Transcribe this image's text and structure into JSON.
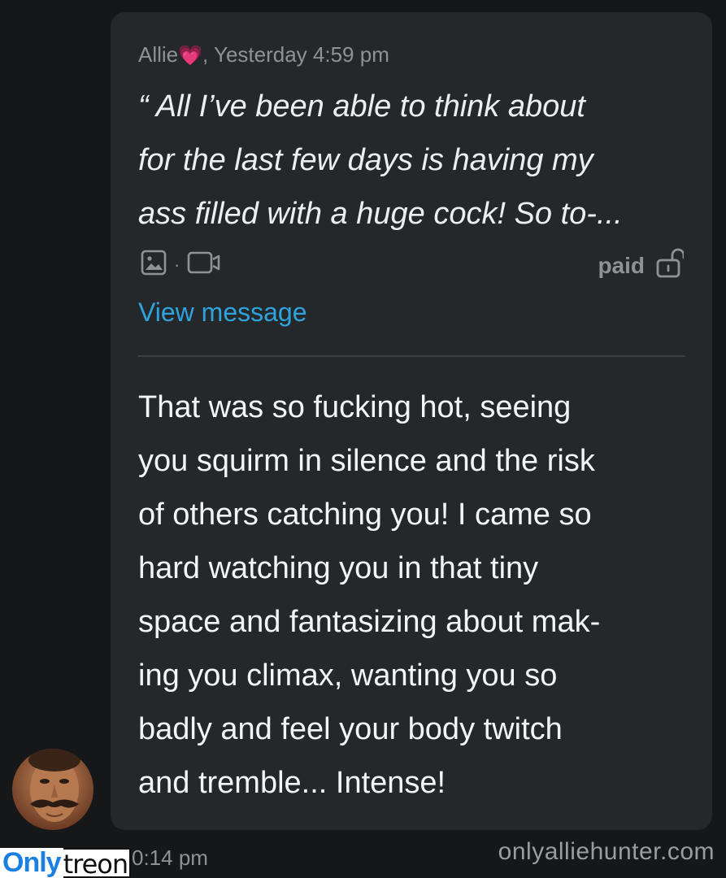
{
  "message": {
    "sender": "Allie",
    "sender_heart": "💗",
    "timestamp": ", Yesterday 4:59 pm",
    "quoted_text": "“ All I’ve been able to think about\nfor the last few days is having my\nass filled with a huge cock! So to-...",
    "media_icons": [
      "image-icon",
      "video-icon"
    ],
    "media_separator": "·",
    "paid_label": "paid",
    "paid_icon": "unlock-icon",
    "view_link": "View message",
    "reply_text": "That was so fucking hot, seeing\nyou squirm in silence and the risk\nof others catching you! I came so\nhard watching you in that tiny\nspace and fantasizing about mak-\ning you climax, wanting you so\nbadly and feel your body twitch\nand tremble... Intense!",
    "sent_time": "0:14 pm"
  },
  "watermarks": {
    "left_only": "Only",
    "left_treon": "treon",
    "right": "onlyalliehunter.com"
  },
  "colors": {
    "background": "#161718",
    "bubble": "#25282b",
    "link": "#2fa3dd",
    "muted": "#8e9296"
  }
}
